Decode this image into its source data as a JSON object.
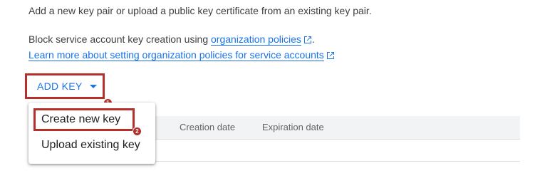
{
  "intro": {
    "text": "Add a new key pair or upload a public key certificate from an existing key pair."
  },
  "policy": {
    "prefix": "Block service account key creation using ",
    "link_label": "organization policies",
    "suffix": "."
  },
  "learn_more": {
    "link_label": "Learn more about setting organization policies for service accounts"
  },
  "add_key": {
    "label": "ADD KEY",
    "badge": "1"
  },
  "menu": {
    "items": [
      {
        "label": "Create new key",
        "badge": "2"
      },
      {
        "label": "Upload existing key"
      }
    ]
  },
  "table": {
    "columns": [
      "Creation date",
      "Expiration date"
    ]
  },
  "colors": {
    "link": "#1a73e8",
    "highlight": "#b5302a"
  },
  "icons": {
    "external_link": "external-link-icon",
    "dropdown": "caret-down-icon"
  }
}
